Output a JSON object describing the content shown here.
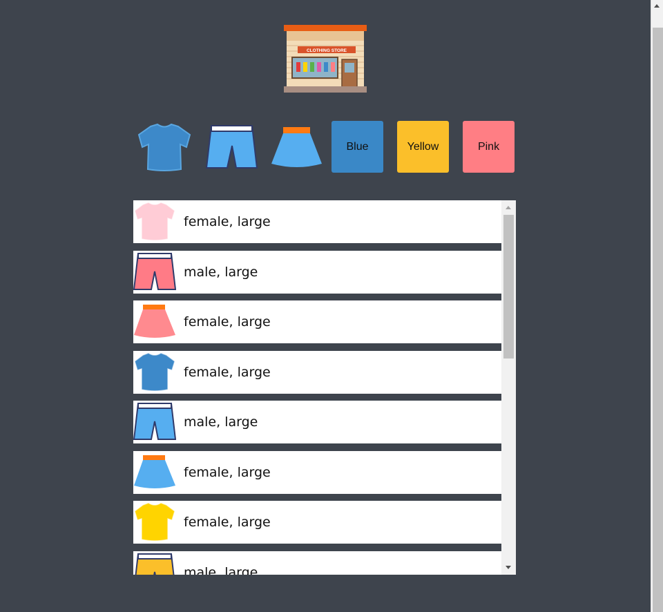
{
  "store": {
    "sign_text": "CLOTHING STORE",
    "icon": "clothing-store-icon"
  },
  "filters": {
    "types": [
      {
        "icon": "tshirt-icon",
        "color": "#3d89c9"
      },
      {
        "icon": "shorts-icon",
        "color": "#56aef0"
      },
      {
        "icon": "skirt-icon",
        "color": "#56aef0"
      }
    ],
    "colors": [
      {
        "label": "Blue",
        "color": "#3a88c7"
      },
      {
        "label": "Yellow",
        "color": "#fbbf2a"
      },
      {
        "label": "Pink",
        "color": "#ff7e84"
      }
    ]
  },
  "items": [
    {
      "icon": "tshirt-icon",
      "color": "#ffccd6",
      "label": "female, large"
    },
    {
      "icon": "shorts-icon",
      "color": "#ff7b86",
      "label": "male, large"
    },
    {
      "icon": "skirt-icon",
      "color": "#ff8a8f",
      "label": "female, large"
    },
    {
      "icon": "tshirt-icon",
      "color": "#3d89c9",
      "label": "female, large"
    },
    {
      "icon": "shorts-icon",
      "color": "#56aef0",
      "label": "male, large"
    },
    {
      "icon": "skirt-icon",
      "color": "#56aef0",
      "label": "female, large"
    },
    {
      "icon": "tshirt-icon",
      "color": "#ffd400",
      "label": "female, large"
    },
    {
      "icon": "shorts-icon",
      "color": "#fbbf2a",
      "label": "male, large"
    }
  ]
}
